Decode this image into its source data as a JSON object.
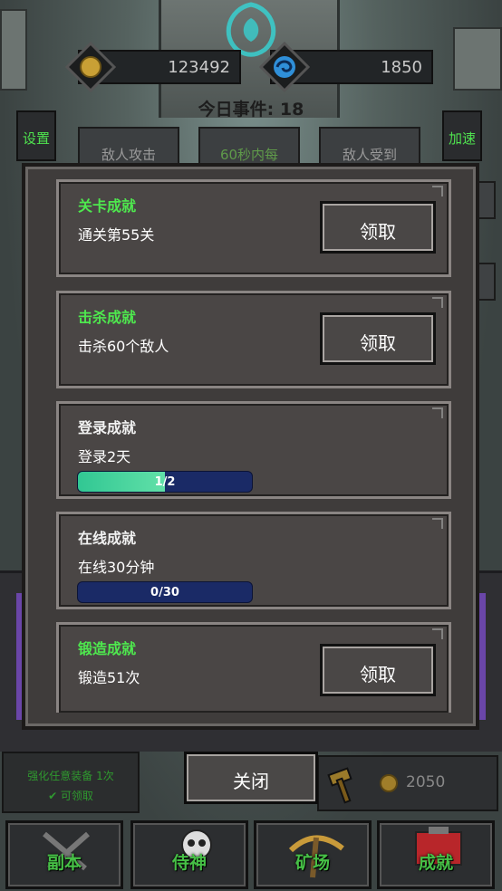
{
  "header": {
    "gold": "123492",
    "gems": "1850",
    "event_label": "今日事件:",
    "event_count": "18"
  },
  "side_buttons": {
    "settings": "设置",
    "speed": "加速"
  },
  "tabs": [
    {
      "label": "敌人攻击"
    },
    {
      "label": "60秒内每"
    },
    {
      "label": "敌人受到"
    }
  ],
  "modal": {
    "achievements": [
      {
        "title": "关卡成就",
        "desc": "通关第55关",
        "claim": "领取",
        "claimable": true
      },
      {
        "title": "击杀成就",
        "desc": "击杀60个敌人",
        "claim": "领取",
        "claimable": true
      },
      {
        "title": "登录成就",
        "desc": "登录2天",
        "progress_text": "1/2",
        "progress": 0.5,
        "claimable": false
      },
      {
        "title": "在线成就",
        "desc": "在线30分钟",
        "progress_text": "0/30",
        "progress": 0.0,
        "claimable": false
      },
      {
        "title": "锻造成就",
        "desc": "锻造51次",
        "claim": "领取",
        "claimable": true
      }
    ],
    "close": "关闭"
  },
  "task": {
    "line1": "强化任意装备 1次",
    "line2": "✔ 可领取"
  },
  "forge": {
    "gold": "2050"
  },
  "nav": [
    {
      "label": "副本"
    },
    {
      "label": "侍神"
    },
    {
      "label": "矿场"
    },
    {
      "label": "成就"
    }
  ],
  "colors": {
    "achievement_green": "#4ee84e",
    "progress_fill": "#31c793",
    "progress_track": "#1a2a66",
    "nav_green": "#46c046"
  }
}
